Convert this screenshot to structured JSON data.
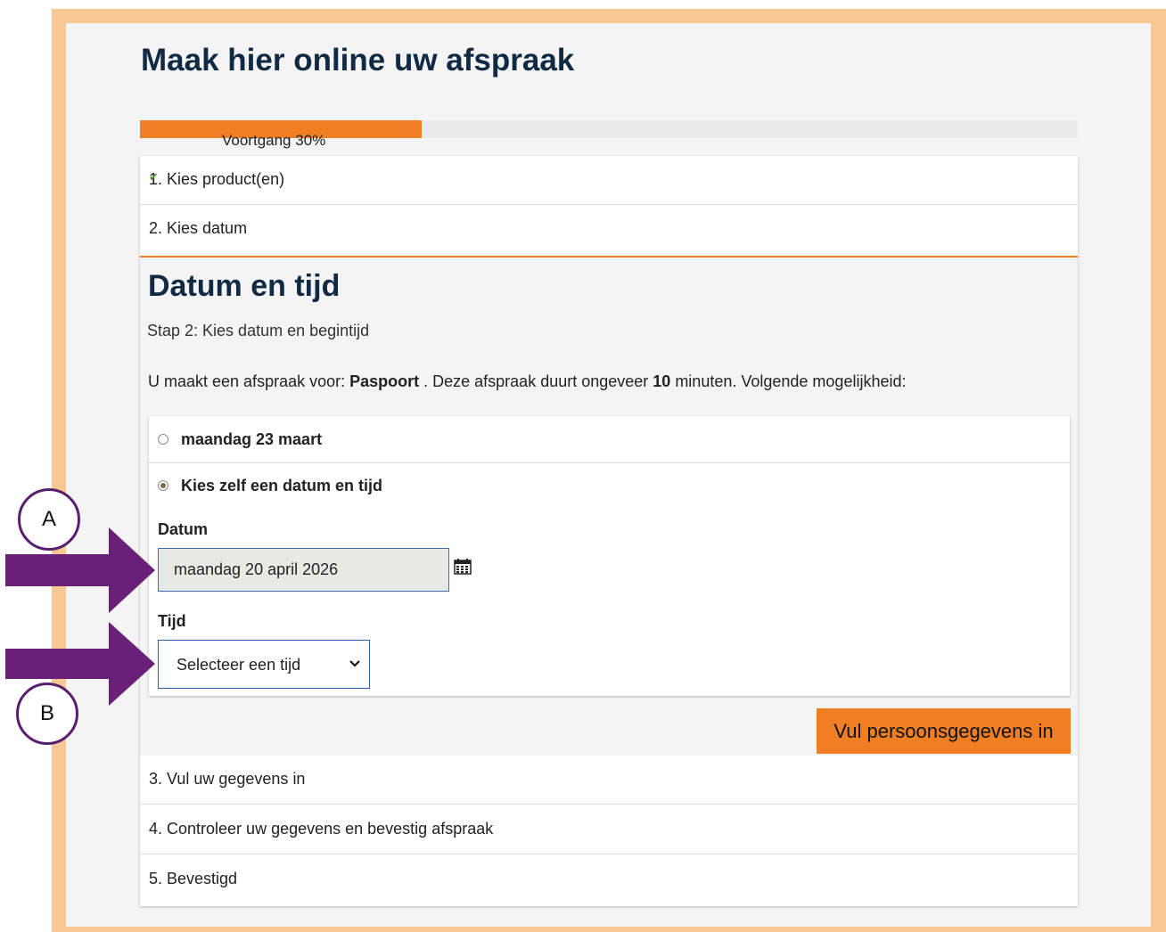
{
  "page": {
    "title": "Maak hier online uw afspraak"
  },
  "progress": {
    "label": "Voortgang 30%",
    "percent": 30,
    "color": "#f07f24"
  },
  "steps": [
    {
      "label": "1. Kies product(en)",
      "completed": true
    },
    {
      "label": "2. Kies datum"
    },
    {
      "label": "3. Vul uw gegevens in"
    },
    {
      "label": "4. Controleer uw gegevens en bevestig afspraak"
    },
    {
      "label": "5. Bevestigd"
    }
  ],
  "active_step": {
    "title": "Datum en tijd",
    "subtitle": "Stap 2: Kies datum en begintijd",
    "info": {
      "prefix": "U maakt een afspraak voor: ",
      "product": "Paspoort",
      "middle": " . Deze afspraak duurt ongeveer ",
      "duration": "10",
      "suffix": " minuten. Volgende mogelijkheid:"
    },
    "options": [
      {
        "label": "maandag 23 maart",
        "selected": false
      },
      {
        "label": "Kies zelf een datum en tijd",
        "selected": true
      }
    ],
    "date_label": "Datum",
    "date_value": "maandag 20 april 2026",
    "time_label": "Tijd",
    "time_select_value": "Selecteer een tijd",
    "next_button": "Vul persoonsgegevens in"
  },
  "annotations": {
    "badge_a": "A",
    "badge_b": "B",
    "arrow_color": "#6a1f78"
  }
}
